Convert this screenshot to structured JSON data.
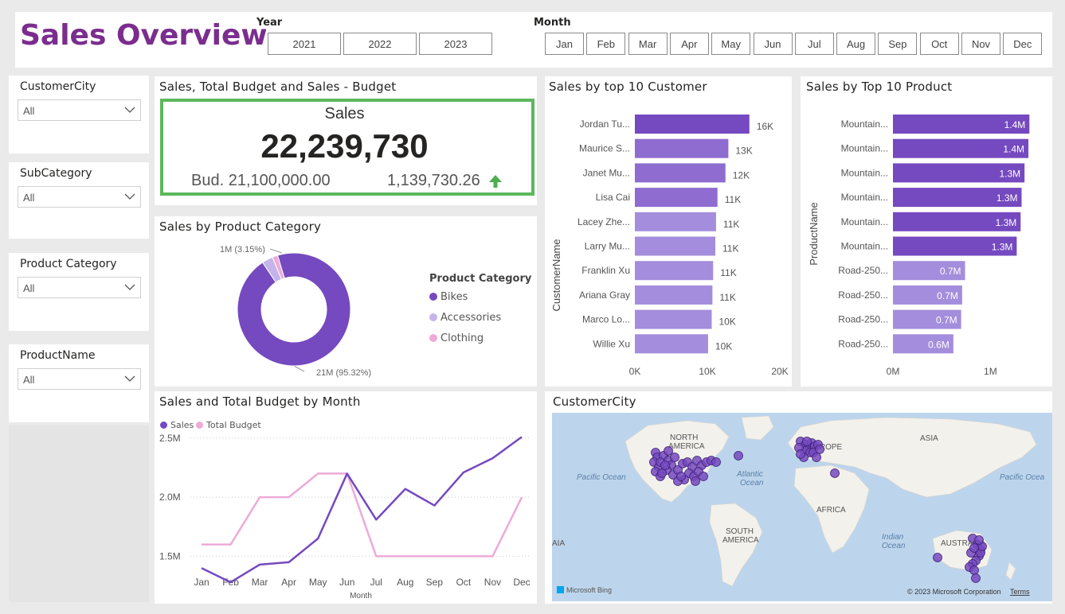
{
  "header": {
    "title": "Sales Overview",
    "year_label": "Year",
    "years": [
      "2021",
      "2022",
      "2023"
    ],
    "month_label": "Month",
    "months": [
      "Jan",
      "Feb",
      "Mar",
      "Apr",
      "May",
      "Jun",
      "Jul",
      "Aug",
      "Sep",
      "Oct",
      "Nov",
      "Dec"
    ]
  },
  "slicers": [
    {
      "title": "CustomerCity",
      "value": "All"
    },
    {
      "title": "SubCategory",
      "value": "All"
    },
    {
      "title": "Product Category",
      "value": "All"
    },
    {
      "title": "ProductName",
      "value": "All"
    }
  ],
  "kpi": {
    "title": "Sales, Total Budget and Sales - Budget",
    "label": "Sales",
    "value": "22,239,730",
    "budget": "Bud. 21,100,000.00",
    "variance": "1,139,730.26",
    "border_color": "#5cb85c",
    "arrow_color": "#4caf50"
  },
  "donut": {
    "title": "Sales by Product Category",
    "legend_title": "Product Category",
    "label_small": "1M (3.15%)",
    "label_big": "21M (95.32%)"
  },
  "customers": {
    "title": "Sales by top 10 Customer",
    "axis_title": "CustomerName"
  },
  "products": {
    "title": "Sales by Top 10 Product",
    "axis_title": "ProductName"
  },
  "monthly": {
    "title": "Sales and Total Budget by Month",
    "xlabel": "Month"
  },
  "map": {
    "title": "CustomerCity",
    "labels": {
      "north_america": "NORTH AMERICA",
      "europe": "EUROPE",
      "asia": "ASIA",
      "africa": "AFRICA",
      "south_america": "SOUTH AMERICA",
      "australia": "AUSTRALIA",
      "pacific_left": "Pacific Ocean",
      "pacific_right": "Pacific Ocea",
      "atlantic": "Atlantic Ocean",
      "indian": "Indian Ocean",
      "asia_edge": "ASIA"
    },
    "copyright": "© 2023 Microsoft Corporation",
    "terms": "Terms",
    "bing": "Microsoft Bing"
  },
  "colors": {
    "title": "#7b2d8e",
    "purple_dark": "#7549c0",
    "purple_mid": "#8f6cd0",
    "purple_light": "#a48ddc",
    "lilac": "#c5b4ea",
    "pink": "#eeaad8",
    "map_water": "#bdd5ec",
    "map_land": "#f3f1ec"
  },
  "chart_data": [
    {
      "type": "pie",
      "title": "Sales by Product Category",
      "legend_title": "Product Category",
      "categories": [
        "Bikes",
        "Accessories",
        "Clothing"
      ],
      "values": [
        95.32,
        3.15,
        1.53
      ],
      "colors": [
        "#7549c0",
        "#c5b4ea",
        "#eeaad8"
      ],
      "legend": "right"
    },
    {
      "type": "bar",
      "orientation": "horizontal",
      "title": "Sales by top 10 Customer",
      "ylabel": "CustomerName",
      "categories": [
        "Jordan Tu...",
        "Maurice S...",
        "Janet Mu...",
        "Lisa Cai",
        "Lacey Zhe...",
        "Larry Mu...",
        "Franklin Xu",
        "Ariana Gray",
        "Marco Lo...",
        "Willie Xu"
      ],
      "values": [
        15800,
        12900,
        12500,
        11400,
        11200,
        11100,
        10800,
        10700,
        10600,
        10100
      ],
      "data_labels": [
        "16K",
        "13K",
        "12K",
        "11K",
        "11K",
        "11K",
        "11K",
        "11K",
        "10K",
        "10K"
      ],
      "xticks": [
        "0K",
        "10K",
        "20K"
      ],
      "xlim": [
        0,
        20000
      ]
    },
    {
      "type": "bar",
      "orientation": "horizontal",
      "title": "Sales by Top 10 Product",
      "ylabel": "ProductName",
      "categories": [
        "Mountain...",
        "Mountain...",
        "Mountain...",
        "Mountain...",
        "Mountain...",
        "Mountain...",
        "Road-250...",
        "Road-250...",
        "Road-250...",
        "Road-250..."
      ],
      "values": [
        1.4,
        1.39,
        1.35,
        1.32,
        1.31,
        1.27,
        0.74,
        0.71,
        0.7,
        0.62
      ],
      "data_labels": [
        "1.4M",
        "1.4M",
        "1.3M",
        "1.3M",
        "1.3M",
        "1.3M",
        "0.7M",
        "0.7M",
        "0.7M",
        "0.6M"
      ],
      "xticks": [
        "0M",
        "1M"
      ],
      "xlim": [
        0,
        1.7
      ]
    },
    {
      "type": "line",
      "title": "Sales and Total Budget by Month",
      "xlabel": "Month",
      "x": [
        "Jan",
        "Feb",
        "Mar",
        "Apr",
        "May",
        "Jun",
        "Jul",
        "Aug",
        "Sep",
        "Oct",
        "Nov",
        "Dec"
      ],
      "series": [
        {
          "name": "Sales",
          "color": "#7549c0",
          "values": [
            1.4,
            1.28,
            1.43,
            1.45,
            1.65,
            2.2,
            1.81,
            2.07,
            1.93,
            2.21,
            2.33,
            2.51
          ]
        },
        {
          "name": "Total Budget",
          "color": "#eeaad8",
          "values": [
            1.6,
            1.6,
            2.0,
            2.0,
            2.2,
            2.2,
            1.5,
            1.5,
            1.5,
            1.5,
            1.5,
            2.0
          ]
        }
      ],
      "yticks": [
        "1.5M",
        "2.0M",
        "2.5M"
      ],
      "ylim": [
        1.2,
        2.6
      ],
      "grid": true,
      "legend": "top-left"
    }
  ]
}
